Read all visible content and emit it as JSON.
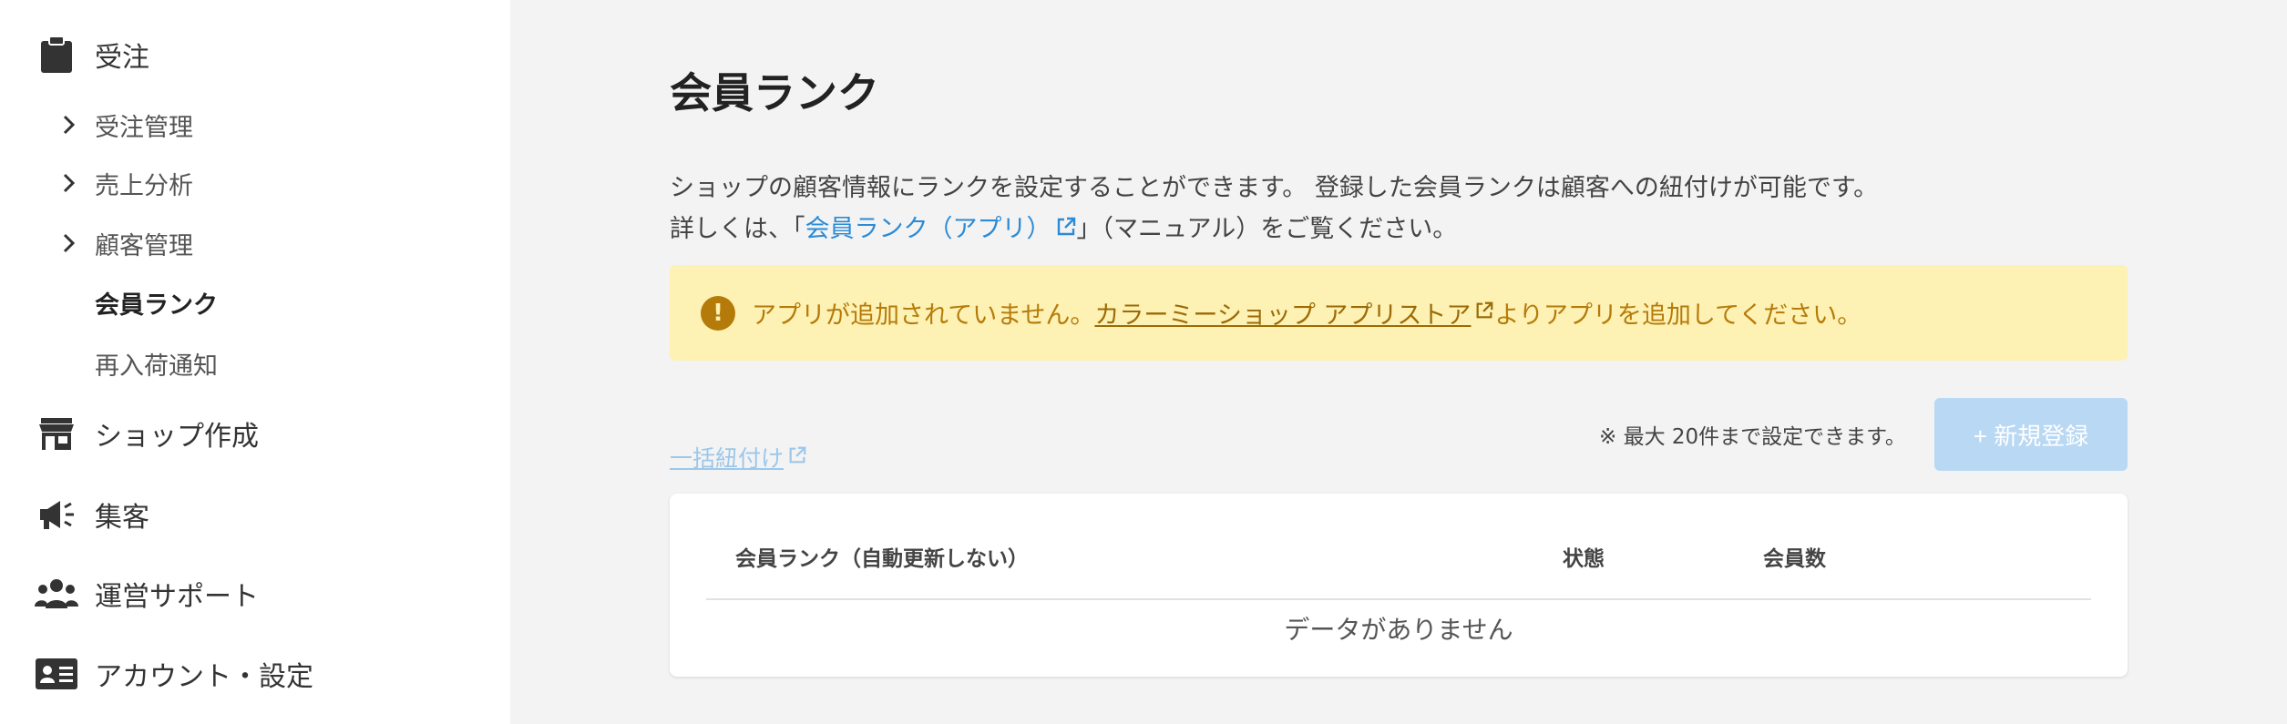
{
  "sidebar": {
    "orders": {
      "label": "受注",
      "icon": "clipboard-icon",
      "items": [
        {
          "label": "受注管理"
        },
        {
          "label": "売上分析"
        },
        {
          "label": "顧客管理"
        },
        {
          "label": "会員ランク"
        },
        {
          "label": "再入荷通知"
        }
      ]
    },
    "groups": [
      {
        "label": "ショップ作成",
        "icon": "store-icon"
      },
      {
        "label": "集客",
        "icon": "megaphone-icon"
      },
      {
        "label": "運営サポート",
        "icon": "people-icon"
      },
      {
        "label": "アカウント・設定",
        "icon": "id-card-icon"
      }
    ]
  },
  "main": {
    "title": "会員ランク",
    "description": {
      "line1": "ショップの顧客情報にランクを設定することができます。 登録した会員ランクは顧客への紐付けが可能です。",
      "line2_prefix": "詳しくは、「",
      "line2_link": "会員ランク（アプリ）",
      "line2_suffix": "」（マニュアル）をご覧ください。"
    },
    "alert": {
      "prefix": "アプリが追加されていません。",
      "link": "カラーミーショップ アプリストア",
      "suffix": "よりアプリを追加してください。",
      "icon": "warning-icon"
    },
    "bulk_link": "一括紐付け",
    "limit_note": "※ 最大 20件まで設定できます。",
    "new_button": "+ 新規登録",
    "table": {
      "headers": [
        "会員ランク（自動更新しない）",
        "状態",
        "会員数"
      ],
      "empty_message": "データがありません"
    }
  },
  "colors": {
    "link": "#2b8bd6",
    "alert_bg": "#fdf1b3",
    "alert_text": "#b57b0a",
    "button_disabled": "#b9d8f3"
  }
}
